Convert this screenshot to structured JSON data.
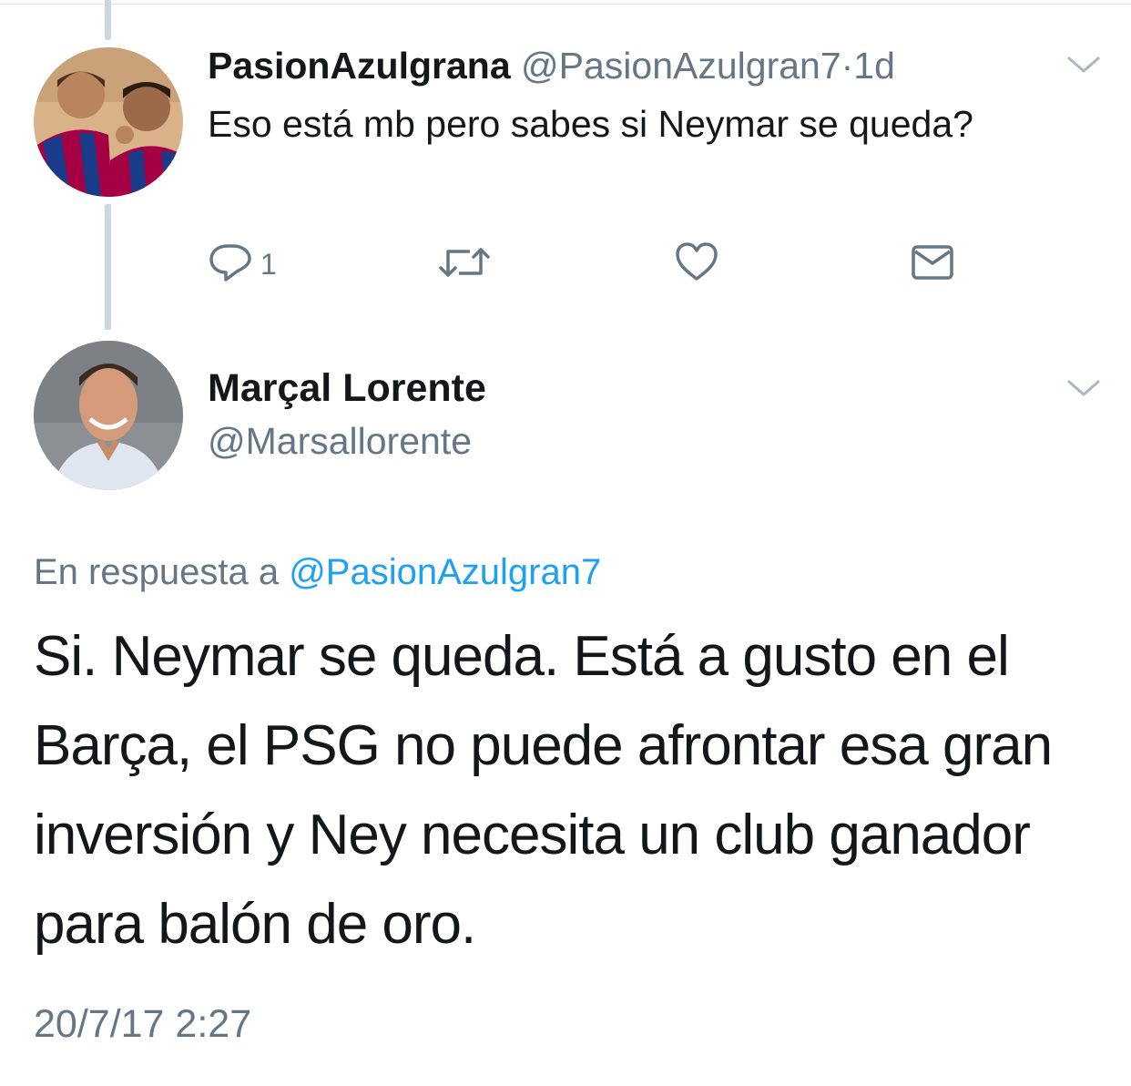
{
  "tweet_reply_parent": {
    "name": "PasionAzulgrana",
    "handle": "@PasionAzulgran7",
    "separator": "·",
    "time": "1d",
    "text": "Eso está mb pero sabes si Neymar se queda?",
    "reply_count": "1"
  },
  "tweet_main": {
    "name": "Marçal Lorente",
    "handle": "@Marsallorente",
    "reply_prefix": "En respuesta a",
    "reply_to": "@PasionAzulgran7",
    "text": "Si. Neymar se queda. Está a gusto en el Barça, el PSG no puede afrontar esa gran inversión y Ney necesita un club ganador para balón de oro.",
    "timestamp": "20/7/17 2:27"
  },
  "icons": {
    "reply": "reply-icon",
    "retweet": "retweet-icon",
    "like": "heart-icon",
    "dm": "envelope-icon",
    "more": "chevron-down-icon"
  },
  "colors": {
    "text": "#14171a",
    "secondary": "#657786",
    "link": "#1da1f2",
    "thread_line": "#ccd6dd"
  }
}
